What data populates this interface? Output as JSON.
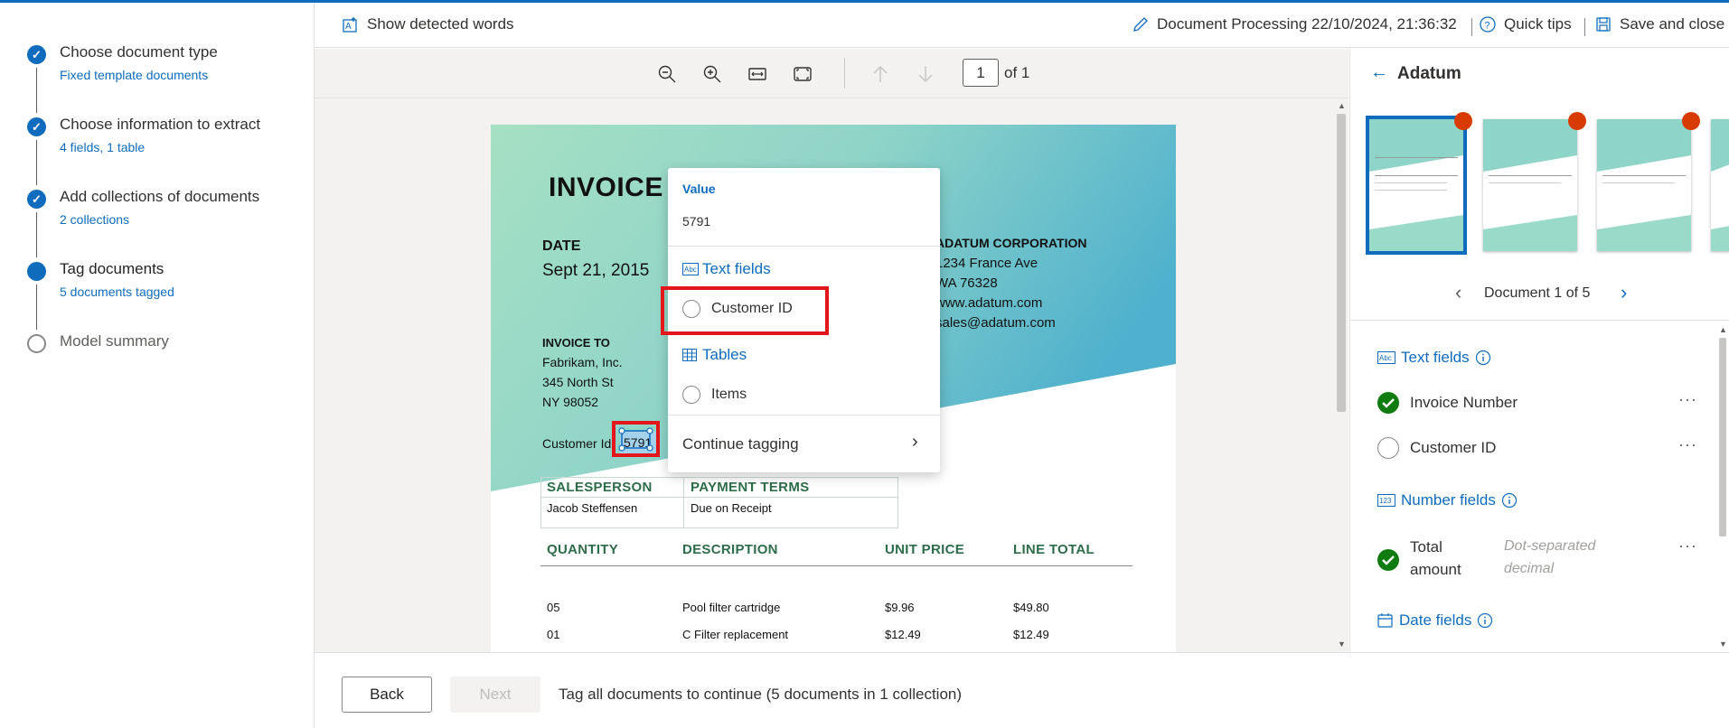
{
  "topbar": {
    "show_words": "Show detected words",
    "doc_title": "Document Processing 22/10/2024, 21:36:32",
    "quick_tips": "Quick tips",
    "save_close": "Save and close"
  },
  "steps": [
    {
      "title": "Choose document type",
      "sub": "Fixed template documents",
      "state": "done"
    },
    {
      "title": "Choose information to extract",
      "sub": "4 fields, 1 table",
      "state": "done"
    },
    {
      "title": "Add collections of documents",
      "sub": "2 collections",
      "state": "done"
    },
    {
      "title": "Tag documents",
      "sub": "5 documents tagged",
      "state": "current"
    },
    {
      "title": "Model summary",
      "sub": "",
      "state": "pending"
    }
  ],
  "viewer": {
    "page_number": "1",
    "page_of": "of 1"
  },
  "invoice": {
    "title": "INVOICE",
    "date_label": "DATE",
    "date_value": "Sept 21, 2015",
    "company": "ADATUM CORPORATION",
    "address1": "1234 France Ave",
    "address2": "WA 76328",
    "web": "www.adatum.com",
    "email": "sales@adatum.com",
    "invoice_to_label": "INVOICE TO",
    "to1": "Fabrikam, Inc.",
    "to2": "345 North St",
    "to3": "NY 98052",
    "customer_id_label": "Customer Id:",
    "customer_id_value": "5791",
    "salesperson_h": "SALESPERSON",
    "payment_h": "PAYMENT TERMS",
    "salesperson": "Jacob Steffensen",
    "payment": "Due on Receipt",
    "cols": [
      "QUANTITY",
      "DESCRIPTION",
      "UNIT PRICE",
      "LINE TOTAL"
    ],
    "rows": [
      [
        "05",
        "Pool filter cartridge",
        "$9.96",
        "$49.80"
      ],
      [
        "01",
        "C Filter replacement",
        "$12.49",
        "$12.49"
      ]
    ]
  },
  "popup": {
    "value_label": "Value",
    "value": "5791",
    "text_fields": "Text fields",
    "customer_id": "Customer ID",
    "tables": "Tables",
    "items": "Items",
    "continue": "Continue tagging"
  },
  "rpanel": {
    "collection": "Adatum",
    "doc_nav": "Document 1 of 5",
    "text_fields": "Text fields",
    "invoice_number": "Invoice Number",
    "customer_id": "Customer ID",
    "number_fields": "Number fields",
    "total_amount_1": "Total",
    "total_amount_2": "amount",
    "total_hint_1": "Dot-separated",
    "total_hint_2": "decimal",
    "date_fields": "Date fields"
  },
  "footer": {
    "back": "Back",
    "next": "Next",
    "message": "Tag all documents to continue (5 documents in 1 collection)"
  },
  "colors": {
    "accent": "#0f6cbd",
    "success": "#107c10",
    "alert": "#d83b01",
    "highlight": "#e3161c"
  }
}
